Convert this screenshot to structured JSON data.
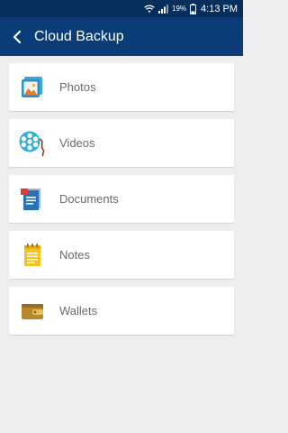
{
  "status_bar": {
    "battery_percent": "19%",
    "time": "4:13 PM",
    "icons": [
      "wifi-icon",
      "signal-icon",
      "battery-icon"
    ]
  },
  "app_bar": {
    "title": "Cloud Backup",
    "back_icon": "chevron-left-icon"
  },
  "items": [
    {
      "label": "Photos",
      "icon": "photos-icon"
    },
    {
      "label": "Videos",
      "icon": "film-reel-icon"
    },
    {
      "label": "Documents",
      "icon": "document-icon"
    },
    {
      "label": "Notes",
      "icon": "notepad-icon"
    },
    {
      "label": "Wallets",
      "icon": "wallet-icon"
    }
  ],
  "colors": {
    "status_bar": "#052e5c",
    "app_bar": "#0a3d78",
    "background": "#eeeeee",
    "card": "#ffffff",
    "label": "#6b6b6b"
  }
}
